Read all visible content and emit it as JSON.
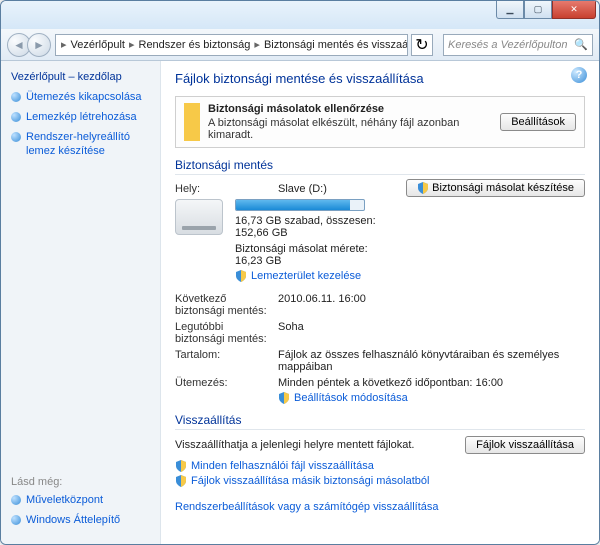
{
  "titlebar": {
    "min": "▁",
    "max": "▢",
    "close": "✕"
  },
  "nav": {
    "back": "◄",
    "forward": "►",
    "breadcrumbs": [
      "Vezérlőpult",
      "Rendszer és biztonság",
      "Biztonsági mentés és visszaállítás"
    ],
    "refresh": "↻",
    "search_placeholder": "Keresés a Vezérlőpulton",
    "search_icon": "🔍"
  },
  "sidebar": {
    "heading": "Vezérlőpult – kezdőlap",
    "links": [
      "Ütemezés kikapcsolása",
      "Lemezkép létrehozása",
      "Rendszer-helyreállító lemez készítése"
    ],
    "also_label": "Lásd még:",
    "also": [
      "Műveletközpont",
      "Windows Áttelepítő"
    ]
  },
  "main": {
    "help": "?",
    "title": "Fájlok biztonsági mentése és visszaállítása",
    "alert": {
      "title": "Biztonsági másolatok ellenőrzése",
      "msg": "A biztonsági másolat elkészült, néhány fájl azonban kimaradt.",
      "button": "Beállítások"
    },
    "backup_section": "Biztonsági mentés",
    "location_label": "Hely:",
    "drive_name": "Slave (D:)",
    "drive_free": "16,73 GB szabad, összesen: 152,66 GB",
    "drive_used_pct": 89,
    "backup_size": "Biztonsági másolat mérete: 16,23 GB",
    "manage_space": "Lemezterület kezelése",
    "make_backup_btn": "Biztonsági másolat készítése",
    "rows": [
      {
        "label": "Következő biztonsági mentés:",
        "value": "2010.06.11. 16:00"
      },
      {
        "label": "Legutóbbi biztonsági mentés:",
        "value": "Soha"
      },
      {
        "label": "Tartalom:",
        "value": "Fájlok az összes felhasználó könyvtáraiban és személyes mappáiban"
      },
      {
        "label": "Ütemezés:",
        "value": "Minden péntek a következő időpontban: 16:00"
      }
    ],
    "change_settings": "Beállítások módosítása",
    "restore_section": "Visszaállítás",
    "restore_text": "Visszaállíthatja a jelenlegi helyre mentett fájlokat.",
    "restore_btn": "Fájlok visszaállítása",
    "restore_links": [
      "Minden felhasználói fájl visszaállítása",
      "Fájlok visszaállítása másik biztonsági másolatból"
    ],
    "system_restore": "Rendszerbeállítások vagy a számítógép visszaállítása"
  }
}
